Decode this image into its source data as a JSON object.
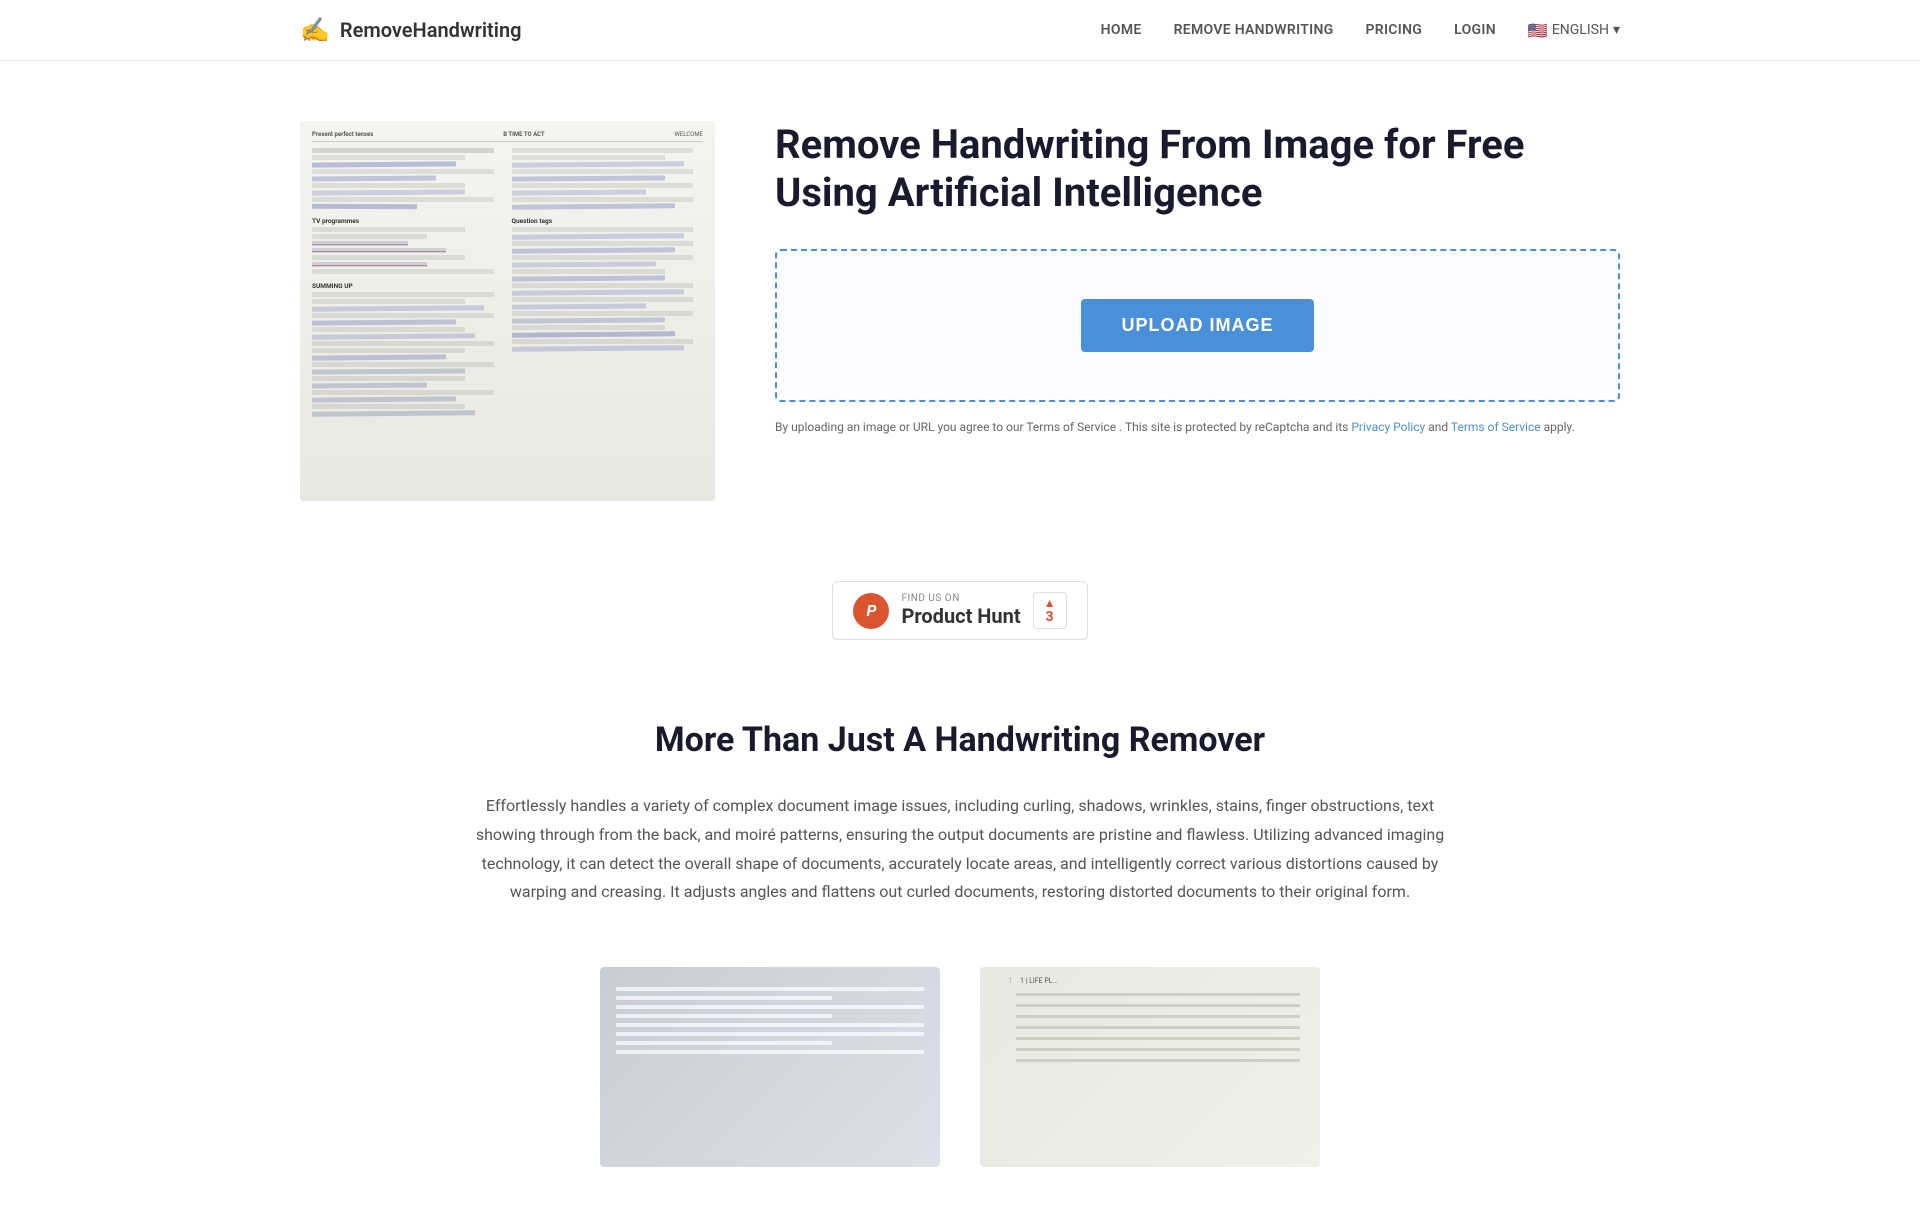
{
  "nav": {
    "logo_text": "RemoveHandwriting",
    "links": [
      {
        "id": "home",
        "label": "HOME"
      },
      {
        "id": "remove-handwriting",
        "label": "REMOVE HANDWRITING"
      },
      {
        "id": "pricing",
        "label": "PRICING"
      },
      {
        "id": "login",
        "label": "LOGIN"
      }
    ],
    "language": "ENGLISH",
    "language_flag": "🇺🇸"
  },
  "hero": {
    "title": "Remove Handwriting From Image for Free Using Artificial Intelligence",
    "upload_btn": "UPLOAD IMAGE",
    "terms_text": "By uploading an image or URL you agree to our Terms of Service . This site is protected by reCaptcha and its",
    "privacy_policy_link": "Privacy Policy",
    "and_text": "and",
    "terms_of_service_link": "Terms of Service",
    "apply_text": "apply."
  },
  "product_hunt": {
    "find_text": "FIND US ON",
    "name": "Product Hunt",
    "logo_letter": "P",
    "upvote_count": "3"
  },
  "more_section": {
    "title": "More Than Just A Handwriting Remover",
    "description": "Effortlessly handles a variety of complex document image issues, including curling, shadows, wrinkles, stains, finger obstructions, text showing through from the back, and moiré patterns, ensuring the output documents are pristine and flawless. Utilizing advanced imaging technology, it can detect the overall shape of documents, accurately locate areas, and intelligently correct various distortions caused by warping and creasing. It adjusts angles and flattens out curled documents, restoring distorted documents to their original form."
  },
  "bottom_images": {
    "left_alt": "Document with curl effect",
    "right_alt": "Document with ruled lines",
    "right_text": "1 | LIFE PL..."
  }
}
